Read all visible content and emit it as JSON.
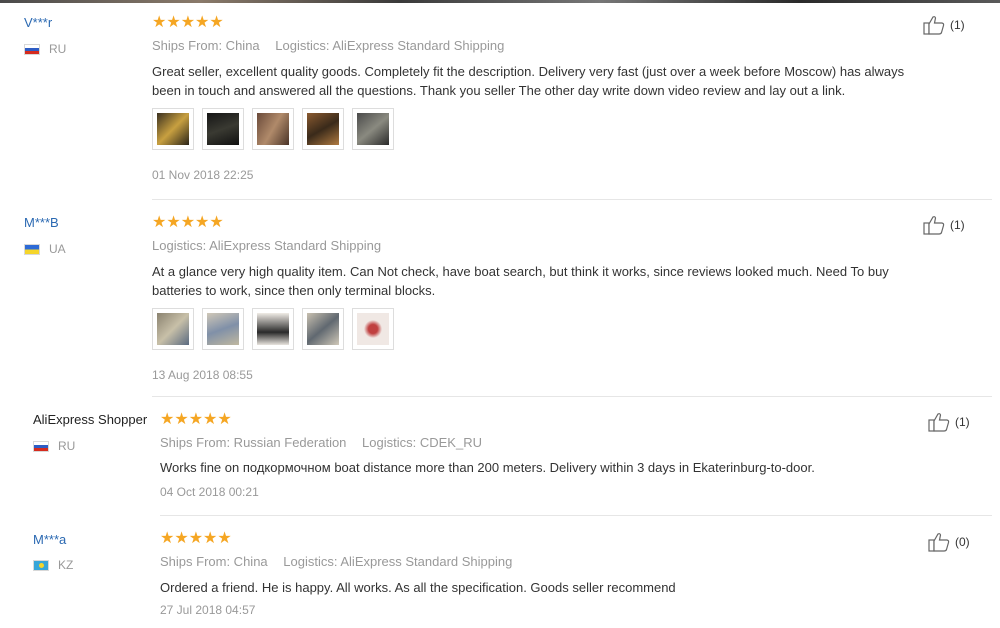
{
  "reviews": [
    {
      "user": "V***r",
      "country": "RU",
      "stars": "★★★★★",
      "ships_from": "Ships From: China",
      "logistics": "Logistics: AliExpress Standard Shipping",
      "text_line1": "Great seller, excellent quality goods. Completely fit the description. Delivery very fast (just over a week before Moscow) has always",
      "text_line2": "been in touch and answered all the questions. Thank you seller The other day write down video review and lay out a link.",
      "date": "01 Nov 2018 22:25",
      "likes": "(1)",
      "photos": [
        "photo",
        "photo",
        "photo",
        "photo",
        "photo"
      ]
    },
    {
      "user": "M***B",
      "country": "UA",
      "stars": "★★★★★",
      "logistics": "Logistics: AliExpress Standard Shipping",
      "text_line1": "At a glance very high quality item. Can Not check, have boat search, but think it works, since reviews looked much. Need To buy",
      "text_line2": "batteries to work, since then only terminal blocks.",
      "date": "13 Aug 2018 08:55",
      "likes": "(1)",
      "photos": [
        "photo",
        "photo",
        "photo",
        "photo",
        "photo"
      ]
    },
    {
      "user": "AliExpress Shopper",
      "country": "RU",
      "stars": "★★★★★",
      "ships_from": "Ships From: Russian Federation",
      "logistics": "Logistics: CDEK_RU",
      "text_line1": "Works fine on подкормочном boat distance more than 200 meters. Delivery within 3 days in Ekaterinburg-to-door.",
      "date": "04 Oct 2018 00:21",
      "likes": "(1)"
    },
    {
      "user": "M***a",
      "country": "KZ",
      "stars": "★★★★★",
      "ships_from": "Ships From: China",
      "logistics": "Logistics: AliExpress Standard Shipping",
      "text_line1": "Ordered a friend. He is happy. All works. As all the specification. Goods seller recommend",
      "date": "27 Jul 2018 04:57",
      "likes": "(0)"
    }
  ],
  "colors": {
    "star": "#f5a623",
    "username_link": "#2b69b2",
    "meta_text": "#999999",
    "divider": "#e6e6e6"
  },
  "icons": {
    "like": "thumbs-up-icon"
  }
}
